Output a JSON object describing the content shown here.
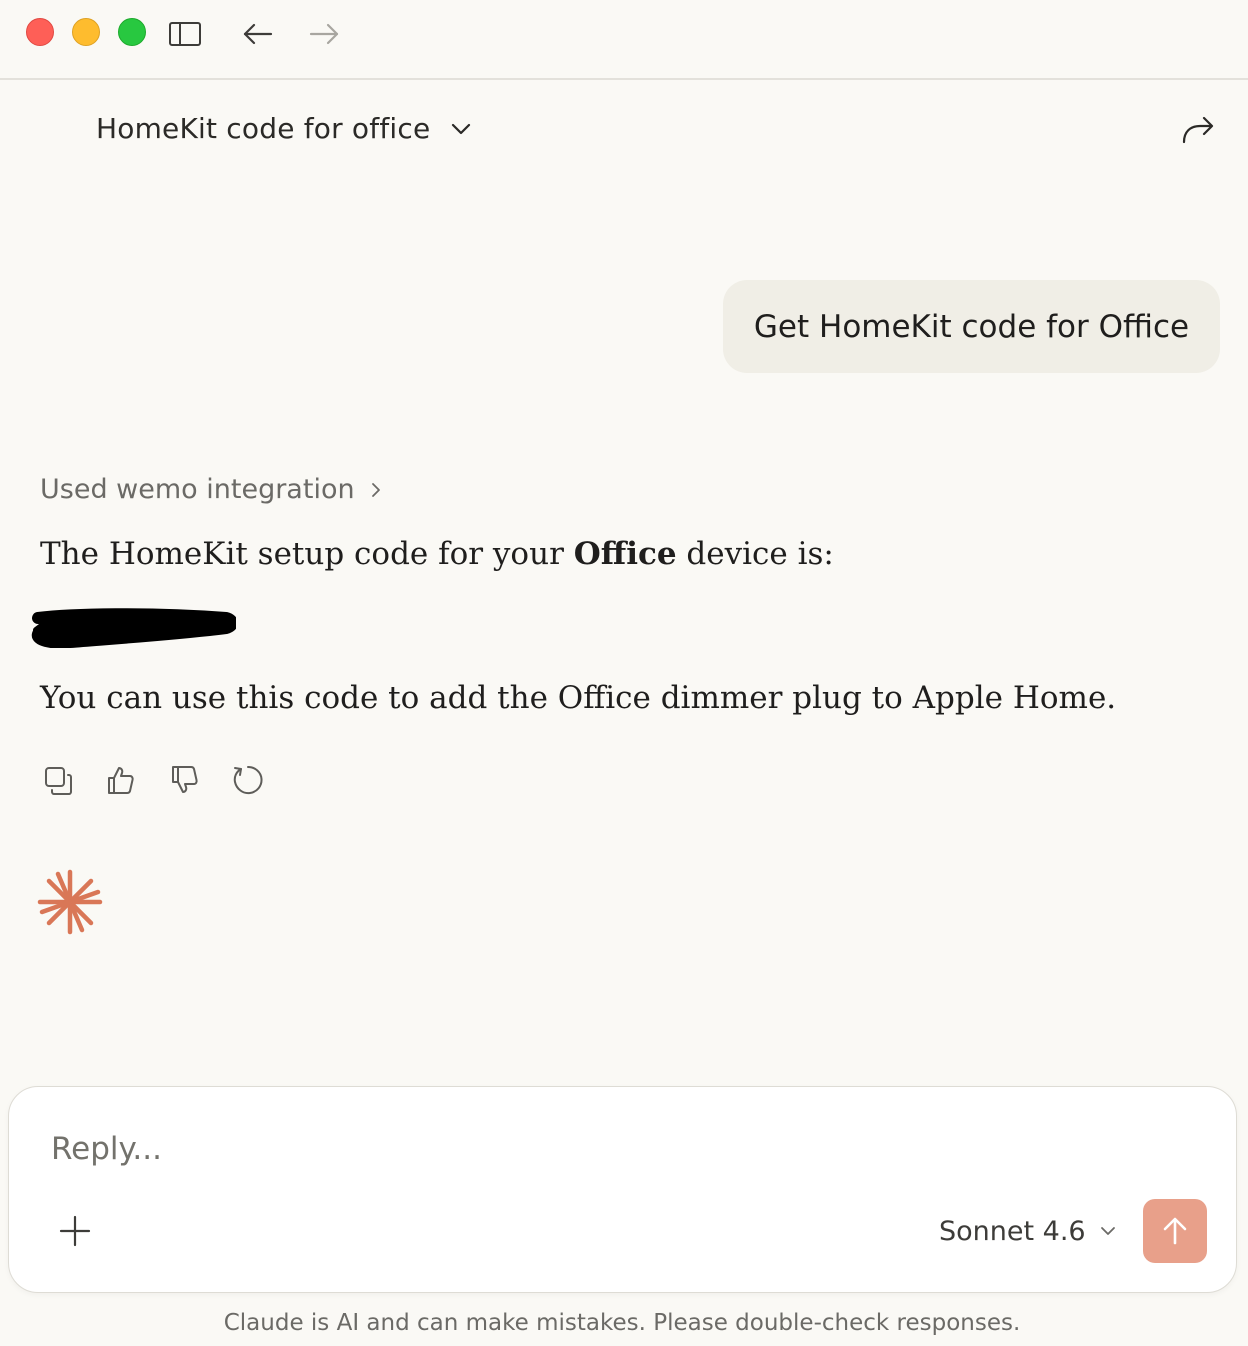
{
  "window": {
    "controls": [
      "close",
      "minimize",
      "maximize"
    ],
    "toolbar_icons": [
      "sidebar-toggle-icon",
      "back-arrow-icon",
      "forward-arrow-icon"
    ]
  },
  "header": {
    "title": "HomeKit code for office",
    "chevron_icon": "chevron-down-icon",
    "share_icon": "share-arrow-icon"
  },
  "messages": {
    "user": {
      "text": "Get HomeKit code for Office"
    },
    "assistant": {
      "tool_used": "Used wemo integration",
      "line1_prefix": "The HomeKit setup code for your ",
      "line1_bold": "Office",
      "line1_suffix": " device is:",
      "redacted_code": "[redacted]",
      "line2": "You can use this code to add the Office dimmer plug to Apple Home.",
      "actions": [
        "copy-icon",
        "thumbs-up-icon",
        "thumbs-down-icon",
        "retry-icon"
      ]
    },
    "thinking_indicator": "claude-spark-icon"
  },
  "composer": {
    "placeholder": "Reply...",
    "value": "",
    "model": "Sonnet 4.6",
    "add_icon": "plus-icon",
    "send_icon": "arrow-up-icon"
  },
  "footer": {
    "disclaimer": "Claude is AI and can make mistakes. Please double-check responses."
  },
  "colors": {
    "background": "#faf9f5",
    "user_bubble": "#f0eee6",
    "accent": "#d97757",
    "send_button": "#e8a08a"
  }
}
